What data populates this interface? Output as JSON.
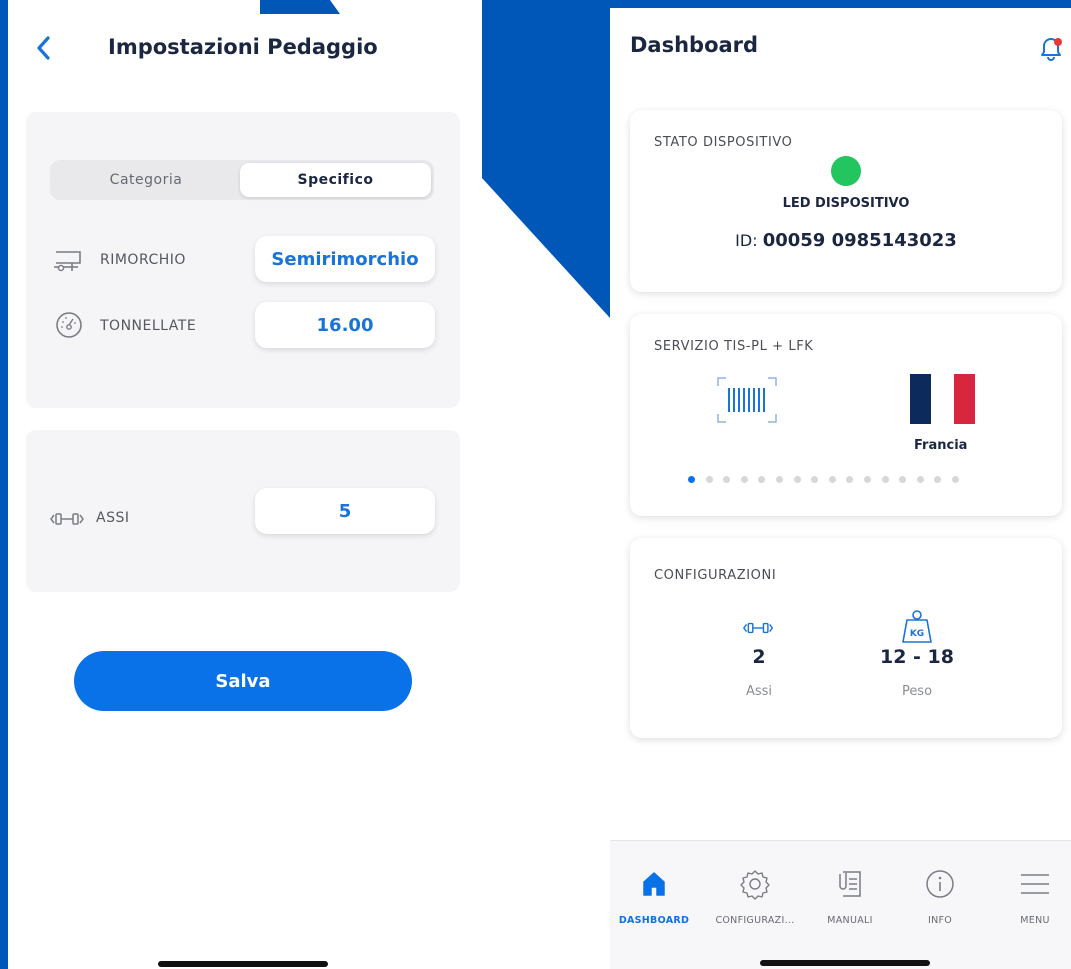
{
  "left_screen": {
    "title": "Impostazioni Pedaggio",
    "segment": {
      "options": [
        "Categoria",
        "Specifico"
      ],
      "selected": "Specifico"
    },
    "rows": [
      {
        "icon": "trailer-icon",
        "label": "RIMORCHIO",
        "value": "Semirimorchio"
      },
      {
        "icon": "gauge-icon",
        "label": "TONNELLATE",
        "value": "16.00"
      },
      {
        "icon": "axle-icon",
        "label": "ASSI",
        "value": "5"
      }
    ],
    "save_label": "Salva"
  },
  "right_screen": {
    "title": "Dashboard",
    "device_card": {
      "title": "STATO DISPOSITIVO",
      "led_label": "LED DISPOSITIVO",
      "led_color": "#22c55e",
      "id_prefix": "ID:",
      "id_value": "00059 0985143023"
    },
    "service_card": {
      "title": "SERVIZIO TIS-PL + LFK",
      "country": "Francia",
      "page_count": 16,
      "current_page": 1
    },
    "config_card": {
      "title": "CONFIGURAZIONI",
      "items": [
        {
          "icon": "axle-icon",
          "value": "2",
          "label": "Assi"
        },
        {
          "icon": "weight-kg-icon",
          "icon_text": "KG",
          "value": "12 - 18",
          "label": "Peso"
        }
      ]
    },
    "tabs": [
      {
        "icon": "home-icon",
        "label": "DASHBOARD",
        "active": true
      },
      {
        "icon": "gear-icon",
        "label": "CONFIGURAZI...",
        "active": false
      },
      {
        "icon": "manual-icon",
        "label": "MANUALI",
        "active": false
      },
      {
        "icon": "info-icon",
        "label": "INFO",
        "active": false
      },
      {
        "icon": "menu-icon",
        "label": "MENU",
        "active": false
      }
    ]
  },
  "colors": {
    "brand_blue": "#0057b8",
    "accent": "#0a72e8",
    "notification": "#e53935"
  }
}
